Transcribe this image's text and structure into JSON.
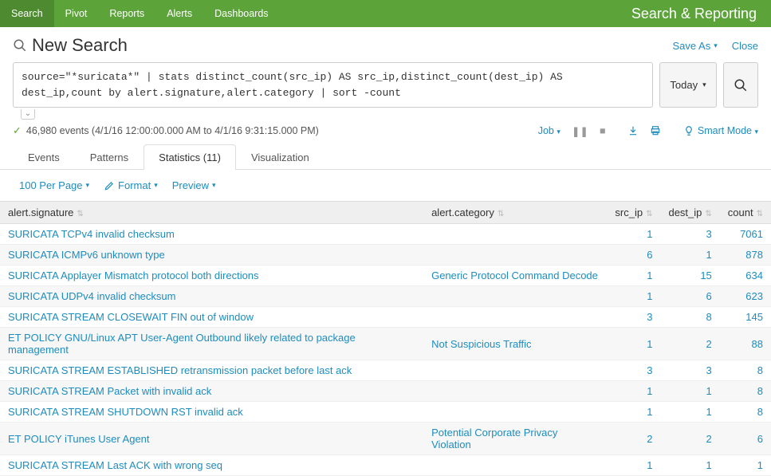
{
  "nav": {
    "items": [
      "Search",
      "Pivot",
      "Reports",
      "Alerts",
      "Dashboards"
    ],
    "active": 0,
    "app_title": "Search & Reporting"
  },
  "search": {
    "title": "New Search",
    "save_as": "Save As",
    "close": "Close",
    "query": "source=\"*suricata*\" | stats distinct_count(src_ip) AS src_ip,distinct_count(dest_ip) AS dest_ip,count by alert.signature,alert.category | sort -count",
    "time_label": "Today"
  },
  "job": {
    "status_text": "46,980 events (4/1/16 12:00:00.000 AM to 4/1/16 9:31:15.000 PM)",
    "job_label": "Job",
    "smart_mode": "Smart Mode"
  },
  "tabs": {
    "items": [
      "Events",
      "Patterns",
      "Statistics (11)",
      "Visualization"
    ],
    "active": 2
  },
  "toolbar": {
    "per_page": "100 Per Page",
    "format": "Format",
    "preview": "Preview"
  },
  "table": {
    "columns": [
      {
        "label": "alert.signature",
        "align": "left"
      },
      {
        "label": "alert.category",
        "align": "left"
      },
      {
        "label": "src_ip",
        "align": "right"
      },
      {
        "label": "dest_ip",
        "align": "right"
      },
      {
        "label": "count",
        "align": "right"
      }
    ],
    "rows": [
      {
        "sig": "SURICATA TCPv4 invalid checksum",
        "cat": "",
        "src": "1",
        "dst": "3",
        "cnt": "7061"
      },
      {
        "sig": "SURICATA ICMPv6 unknown type",
        "cat": "",
        "src": "6",
        "dst": "1",
        "cnt": "878"
      },
      {
        "sig": "SURICATA Applayer Mismatch protocol both directions",
        "cat": "Generic Protocol Command Decode",
        "src": "1",
        "dst": "15",
        "cnt": "634"
      },
      {
        "sig": "SURICATA UDPv4 invalid checksum",
        "cat": "",
        "src": "1",
        "dst": "6",
        "cnt": "623"
      },
      {
        "sig": "SURICATA STREAM CLOSEWAIT FIN out of window",
        "cat": "",
        "src": "3",
        "dst": "8",
        "cnt": "145"
      },
      {
        "sig": "ET POLICY GNU/Linux APT User-Agent Outbound likely related to package management",
        "cat": "Not Suspicious Traffic",
        "src": "1",
        "dst": "2",
        "cnt": "88"
      },
      {
        "sig": "SURICATA STREAM ESTABLISHED retransmission packet before last ack",
        "cat": "",
        "src": "3",
        "dst": "3",
        "cnt": "8"
      },
      {
        "sig": "SURICATA STREAM Packet with invalid ack",
        "cat": "",
        "src": "1",
        "dst": "1",
        "cnt": "8"
      },
      {
        "sig": "SURICATA STREAM SHUTDOWN RST invalid ack",
        "cat": "",
        "src": "1",
        "dst": "1",
        "cnt": "8"
      },
      {
        "sig": "ET POLICY iTunes User Agent",
        "cat": "Potential Corporate Privacy Violation",
        "src": "2",
        "dst": "2",
        "cnt": "6"
      },
      {
        "sig": "SURICATA STREAM Last ACK with wrong seq",
        "cat": "",
        "src": "1",
        "dst": "1",
        "cnt": "1"
      }
    ]
  }
}
